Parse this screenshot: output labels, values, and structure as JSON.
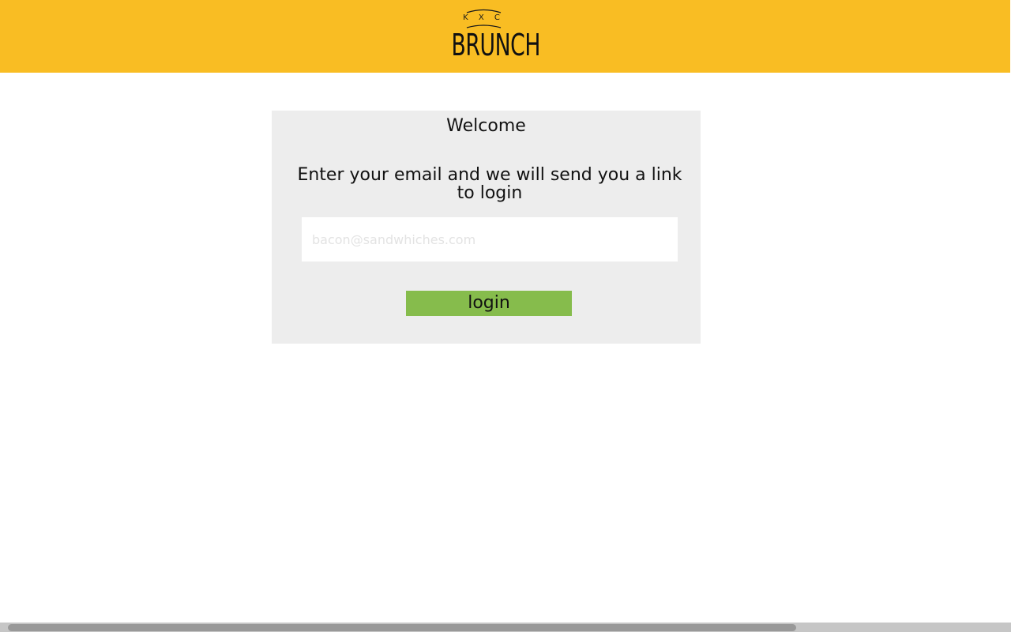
{
  "header": {
    "background_color": "#f9bd23",
    "logo": {
      "initials": "K X C",
      "word": "BRUNCH"
    }
  },
  "login_card": {
    "title": "Welcome",
    "message": "Enter your email and we will send you a link to login",
    "email_placeholder": "bacon@sandwhiches.com",
    "email_value": "",
    "button_label": "login",
    "button_color": "#86bc4c",
    "card_color": "#ededed"
  },
  "scrollbar": {
    "orientation": "horizontal"
  }
}
